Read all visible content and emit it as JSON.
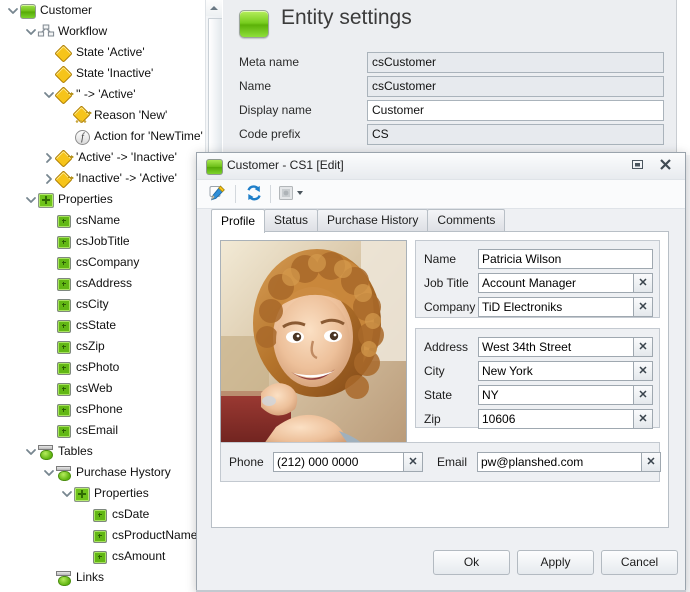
{
  "tree": {
    "items": [
      {
        "label": "Customer",
        "depth": 0,
        "expander": "down",
        "icon": "entity-icon"
      },
      {
        "label": "Workflow",
        "depth": 1,
        "expander": "down",
        "icon": "workflow-icon"
      },
      {
        "label": "State 'Active'",
        "depth": 2,
        "expander": "none",
        "icon": "state-diamond-icon"
      },
      {
        "label": "State 'Inactive'",
        "depth": 2,
        "expander": "none",
        "icon": "state-diamond-icon"
      },
      {
        "label": "'' -> 'Active'",
        "depth": 2,
        "expander": "down",
        "icon": "transition-icon"
      },
      {
        "label": "Reason 'New'",
        "depth": 3,
        "expander": "none",
        "icon": "reason-icon"
      },
      {
        "label": "Action for 'NewTime'",
        "depth": 3,
        "expander": "none",
        "icon": "action-function-icon"
      },
      {
        "label": "'Active' -> 'Inactive'",
        "depth": 2,
        "expander": "right",
        "icon": "transition-icon"
      },
      {
        "label": "'Inactive' -> 'Active'",
        "depth": 2,
        "expander": "right",
        "icon": "transition-icon"
      },
      {
        "label": "Properties",
        "depth": 1,
        "expander": "down",
        "icon": "properties-icon"
      },
      {
        "label": "csName",
        "depth": 2,
        "expander": "none",
        "icon": "property-icon"
      },
      {
        "label": "csJobTitle",
        "depth": 2,
        "expander": "none",
        "icon": "property-icon"
      },
      {
        "label": "csCompany",
        "depth": 2,
        "expander": "none",
        "icon": "property-icon"
      },
      {
        "label": "csAddress",
        "depth": 2,
        "expander": "none",
        "icon": "property-icon"
      },
      {
        "label": "csCity",
        "depth": 2,
        "expander": "none",
        "icon": "property-icon"
      },
      {
        "label": "csState",
        "depth": 2,
        "expander": "none",
        "icon": "property-icon"
      },
      {
        "label": "csZip",
        "depth": 2,
        "expander": "none",
        "icon": "property-icon"
      },
      {
        "label": "csPhoto",
        "depth": 2,
        "expander": "none",
        "icon": "property-icon"
      },
      {
        "label": "csWeb",
        "depth": 2,
        "expander": "none",
        "icon": "property-icon"
      },
      {
        "label": "csPhone",
        "depth": 2,
        "expander": "none",
        "icon": "property-icon"
      },
      {
        "label": "csEmail",
        "depth": 2,
        "expander": "none",
        "icon": "property-icon"
      },
      {
        "label": "Tables",
        "depth": 1,
        "expander": "down",
        "icon": "tables-icon"
      },
      {
        "label": "Purchase Hystory",
        "depth": 2,
        "expander": "down",
        "icon": "table-icon"
      },
      {
        "label": "Properties",
        "depth": 3,
        "expander": "down",
        "icon": "properties-icon"
      },
      {
        "label": "csDate",
        "depth": 4,
        "expander": "none",
        "icon": "property-icon"
      },
      {
        "label": "csProductName",
        "depth": 4,
        "expander": "none",
        "icon": "property-icon"
      },
      {
        "label": "csAmount",
        "depth": 4,
        "expander": "none",
        "icon": "property-icon"
      },
      {
        "label": "Links",
        "depth": 2,
        "expander": "none",
        "icon": "links-icon"
      }
    ]
  },
  "scrollbar": {
    "up_arrow_name": "scroll-up-arrow"
  },
  "entity_settings": {
    "title": "Entity settings",
    "icon": "entity-icon",
    "fields": [
      {
        "label": "Meta name",
        "value": "csCustomer",
        "editable": false
      },
      {
        "label": "Name",
        "value": "csCustomer",
        "editable": false
      },
      {
        "label": "Display name",
        "value": "Customer",
        "editable": true
      },
      {
        "label": "Code prefix",
        "value": "CS",
        "editable": false
      }
    ]
  },
  "dialog": {
    "title": "Customer - CS1 [Edit]",
    "window_buttons": {
      "restore": "□",
      "close": "✖"
    },
    "toolbar": {
      "edit_icon": "edit-pencil-icon",
      "refresh_icon": "refresh-icon",
      "settings_icon": "settings-dropdown-icon",
      "dropdown_caret": "▾"
    },
    "tabs": [
      {
        "label": "Profile",
        "active": true
      },
      {
        "label": "Status",
        "active": false
      },
      {
        "label": "Purchase History",
        "active": false
      },
      {
        "label": "Comments",
        "active": false
      }
    ],
    "photo": {
      "name": "customer-photo",
      "alt": "Portrait of smiling woman with curly hair"
    },
    "group_person": [
      {
        "label": "Name",
        "value": "Patricia Wilson",
        "clear": false
      },
      {
        "label": "Job Title",
        "value": "Account Manager",
        "clear": true
      },
      {
        "label": "Company",
        "value": "TiD Electroniks",
        "clear": true
      }
    ],
    "group_address": [
      {
        "label": "Address",
        "value": "West 34th Street",
        "clear": true
      },
      {
        "label": "City",
        "value": "New York",
        "clear": true
      },
      {
        "label": "State",
        "value": "NY",
        "clear": true
      },
      {
        "label": "Zip",
        "value": "10606",
        "clear": true
      }
    ],
    "group_contact": [
      {
        "label": "Phone",
        "value": "(212) 000 0000",
        "clear": true
      },
      {
        "label": "Email",
        "value": "pw@planshed.com",
        "clear": true
      }
    ],
    "clear_glyph": "✕",
    "buttons": [
      {
        "label": "Ok"
      },
      {
        "label": "Apply"
      },
      {
        "label": "Cancel"
      }
    ]
  },
  "colors": {
    "accent_green": "#6ec018",
    "state_yellow": "#f6c41a",
    "dialog_bg": "#eef0f3",
    "panel_bg": "#eceef1"
  }
}
